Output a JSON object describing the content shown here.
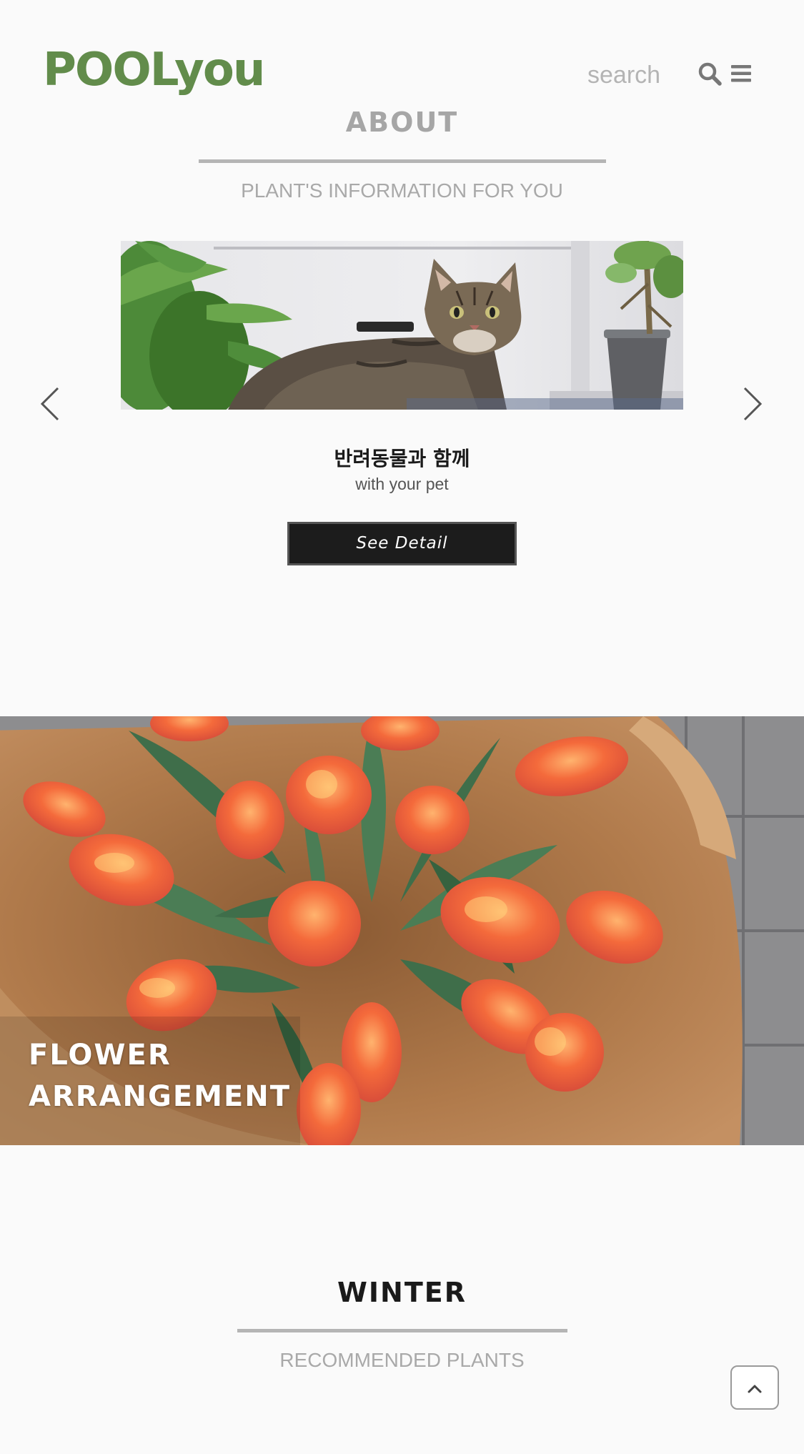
{
  "header": {
    "logo": "POOLyou",
    "search_placeholder": "search",
    "search_icon": "search-icon",
    "menu_icon": "hamburger-menu-icon"
  },
  "about": {
    "title": "ABOUT",
    "subtitle": "PLANT'S INFORMATION FOR YOU"
  },
  "slider": {
    "prev_icon": "chevron-left-icon",
    "next_icon": "chevron-right-icon",
    "image": "cat-with-plants-photo",
    "title": "반려동물과 함께",
    "subtitle": "with your pet",
    "button_label": "See Detail"
  },
  "banner": {
    "image": "orange-tulips-bouquet-photo",
    "label_line1": "FLOWER",
    "label_line2": "ARRANGEMENT"
  },
  "winter": {
    "title": "WINTER",
    "subtitle": "RECOMMENDED PLANTS"
  },
  "scroll_top_icon": "chevron-up-icon",
  "colors": {
    "brand_green": "#628c4b",
    "button_dark": "#1c1c1c",
    "muted_text": "#a9a9a9"
  }
}
